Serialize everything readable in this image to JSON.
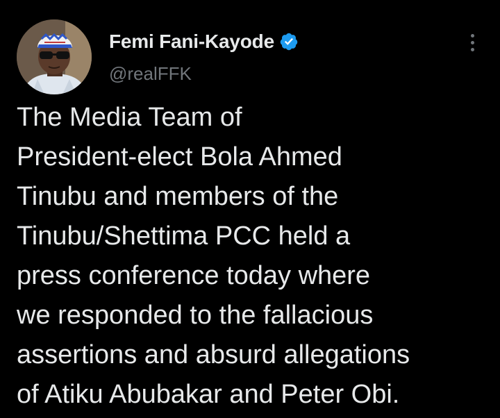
{
  "tweet": {
    "author": {
      "display_name": "Femi Fani-Kayode",
      "handle": "@realFFK",
      "verified": true,
      "verified_icon": "verified-badge-icon",
      "verified_color": "#1d9bf0"
    },
    "more_icon": "more-options-icon",
    "body_lines": [
      "The Media Team of",
      "President-elect Bola Ahmed",
      "Tinubu and members of the",
      "Tinubu/Shettima PCC held a",
      "press conference today where",
      "we responded to the fallacious",
      "assertions and absurd allegations",
      "of Atiku Abubakar and Peter Obi."
    ]
  },
  "colors": {
    "background": "#000000",
    "text_primary": "#e7e9ea",
    "text_secondary": "#71767b",
    "accent": "#1d9bf0"
  }
}
